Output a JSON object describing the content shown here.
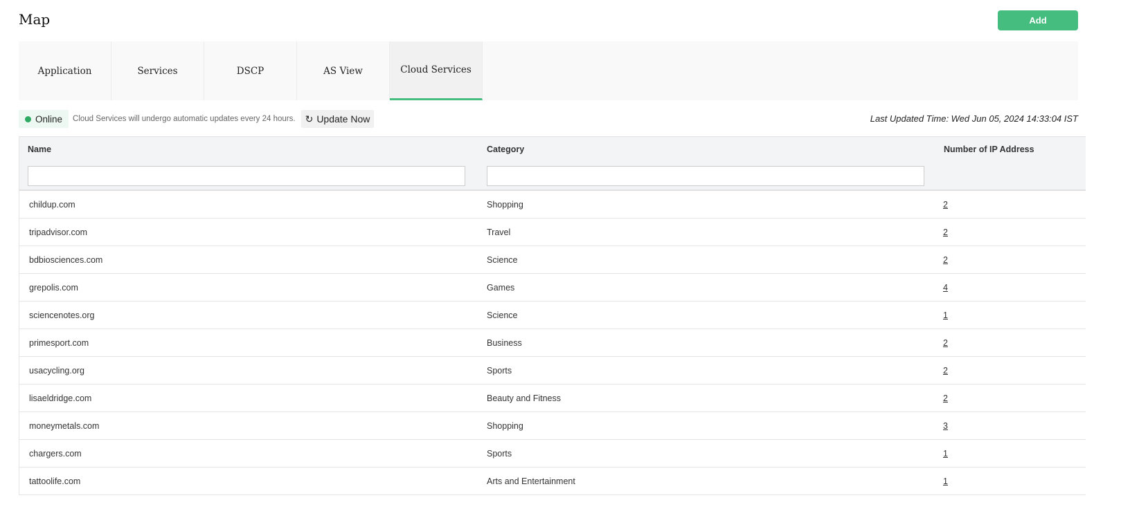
{
  "header": {
    "title": "Map",
    "add_label": "Add"
  },
  "tabs": [
    {
      "label": "Application"
    },
    {
      "label": "Services"
    },
    {
      "label": "DSCP"
    },
    {
      "label": "AS View"
    },
    {
      "label": "Cloud Services",
      "active": true
    }
  ],
  "status": {
    "state": "Online",
    "state_color": "#2eaa62",
    "note": "Cloud Services will undergo automatic updates every 24 hours.",
    "update_label": "Update Now",
    "update_icon": "refresh-icon",
    "last_updated": "Last Updated Time: Wed Jun 05, 2024 14:33:04 IST"
  },
  "accent": "#44bd7f",
  "table": {
    "columns": [
      "Name",
      "Category",
      "Number of IP Address"
    ],
    "filters": {
      "name": "",
      "category": ""
    },
    "rows": [
      {
        "name": "childup.com",
        "category": "Shopping",
        "ips": "2"
      },
      {
        "name": "tripadvisor.com",
        "category": "Travel",
        "ips": "2"
      },
      {
        "name": "bdbiosciences.com",
        "category": "Science",
        "ips": "2"
      },
      {
        "name": "grepolis.com",
        "category": "Games",
        "ips": "4"
      },
      {
        "name": "sciencenotes.org",
        "category": "Science",
        "ips": "1"
      },
      {
        "name": "primesport.com",
        "category": "Business",
        "ips": "2"
      },
      {
        "name": "usacycling.org",
        "category": "Sports",
        "ips": "2"
      },
      {
        "name": "lisaeldridge.com",
        "category": "Beauty and Fitness",
        "ips": "2"
      },
      {
        "name": "moneymetals.com",
        "category": "Shopping",
        "ips": "3"
      },
      {
        "name": "chargers.com",
        "category": "Sports",
        "ips": "1"
      },
      {
        "name": "tattoolife.com",
        "category": "Arts and Entertainment",
        "ips": "1"
      }
    ]
  }
}
